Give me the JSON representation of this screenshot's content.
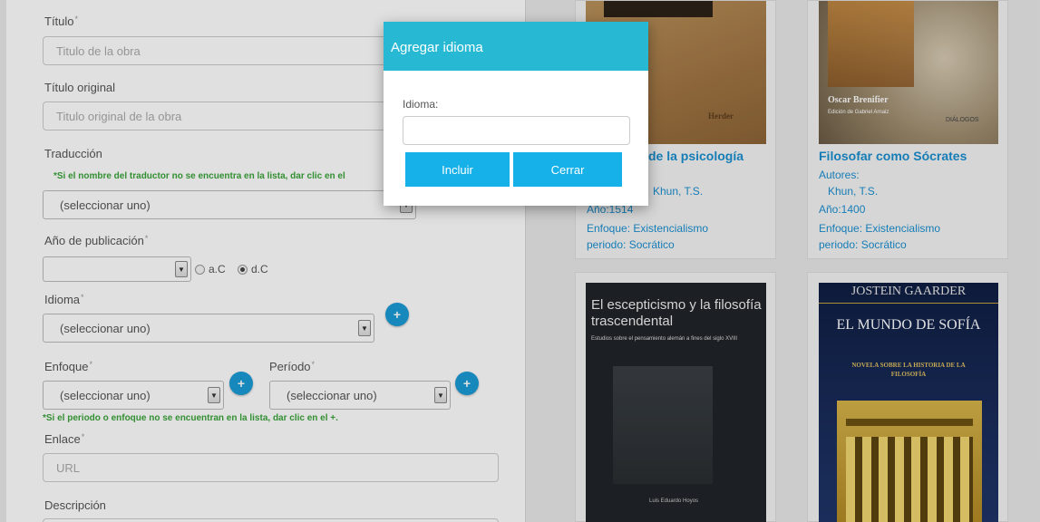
{
  "form": {
    "titulo_label": "Título",
    "titulo_placeholder": "Titulo de la obra",
    "titulo_original_label": "Título original",
    "titulo_original_placeholder": "Titulo original de la obra",
    "traduccion_label": "Traducción",
    "traduccion_hint": "*Si el nombre del traductor no se encuentra en la lista, dar clic en el",
    "traduccion_select": "(seleccionar uno)",
    "anio_label": "Año de publicación",
    "anio_select": "",
    "era_ac": "a.C",
    "era_dc": "d.C",
    "era_selected": "d.C",
    "idioma_label": "Idioma",
    "idioma_select": "(seleccionar uno)",
    "enfoque_label": "Enfoque",
    "enfoque_select": "(seleccionar uno)",
    "periodo_label": "Período",
    "periodo_select": "(seleccionar uno)",
    "periodo_hint": "*Si el periodo o enfoque no se encuentran en la lista, dar clic en el +.",
    "enlace_label": "Enlace",
    "enlace_placeholder": "URL",
    "descripcion_label": "Descripción",
    "required_mark": "*",
    "plus_symbol": "+"
  },
  "books": [
    {
      "title": "de la psicología",
      "cover_text": "Herder",
      "authors_label": "",
      "author": "Khun, T.S.",
      "year": "Año:1514",
      "enfoque": "Enfoque: Existencialismo",
      "periodo": "periodo: Socrático"
    },
    {
      "title": "Filosofar como Sócrates",
      "cover_title": "Oscar Brenifier",
      "cover_sub": "Edición de Gabriel Arnaiz",
      "cover_tag": "DIÁLOGOS",
      "authors_label": "Autores:",
      "author": "Khun, T.S.",
      "year": "Año:1400",
      "enfoque": "Enfoque: Existencialismo",
      "periodo": "periodo: Socrático"
    },
    {
      "cover_title": "El escepticismo y la filosofía trascendental",
      "cover_sub": "Estudios sobre el pensamiento alemán a fines del siglo XVIII",
      "cover_author": "Luis Eduardo Hoyos"
    },
    {
      "cover_author": "JOSTEIN GAARDER",
      "cover_title": "EL MUNDO DE SOFÍA",
      "cover_sub": "NOVELA SOBRE LA HISTORIA DE LA FILOSOFÍA"
    }
  ],
  "modal": {
    "title": "Agregar idioma",
    "field_label": "Idioma:",
    "field_value": "",
    "include_button": "Incluir",
    "close_button": "Cerrar"
  },
  "colors": {
    "modal_header": "#27b9d4",
    "button": "#15b1e8",
    "link": "#1a8fd0",
    "hint": "#3aa33a",
    "plus": "#1a9bd7"
  }
}
